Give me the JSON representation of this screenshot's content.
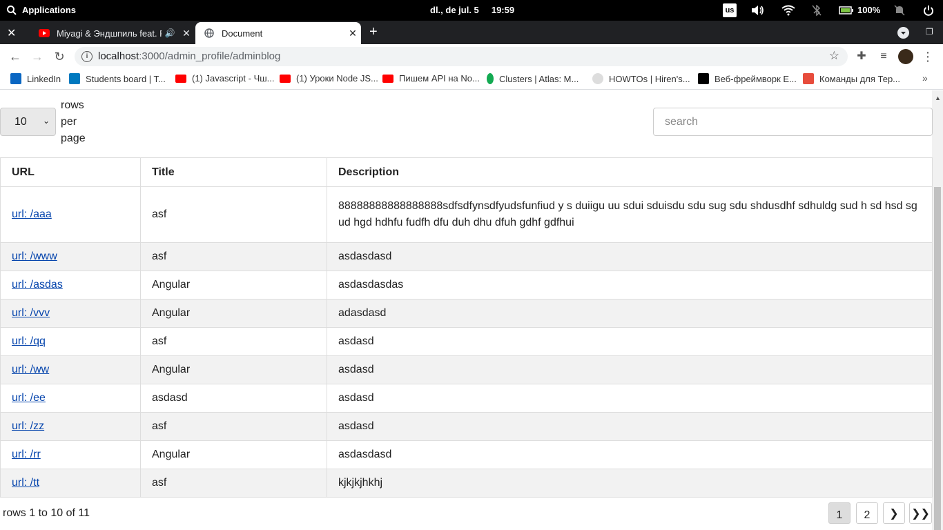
{
  "os": {
    "applications": "Applications",
    "clock": "dl., de jul. 5     19:59",
    "keyboard": "us",
    "battery": "100%"
  },
  "browser": {
    "tabs": [
      {
        "title": "Miyagi & Эндшпиль feat. F",
        "active": false
      },
      {
        "title": "Document",
        "active": true
      }
    ],
    "url_host": "localhost",
    "url_path": ":3000/admin_profile/adminblog",
    "bookmarks": [
      {
        "label": "LinkedIn",
        "color": "#0a66c2"
      },
      {
        "label": "Students board | T...",
        "color": "#0079bf"
      },
      {
        "label": "(1) Javascript - Чш...",
        "color": "#ff0000"
      },
      {
        "label": "(1) Уроки Node JS...",
        "color": "#ff0000"
      },
      {
        "label": "Пишем API на No...",
        "color": "#ff0000"
      },
      {
        "label": "Clusters | Atlas: M...",
        "color": "#13aa52"
      },
      {
        "label": "HOWTOs | Hiren's...",
        "color": "#999999"
      },
      {
        "label": "Веб-фреймворк Е...",
        "color": "#000000"
      },
      {
        "label": "Команды для Тер...",
        "color": "#e74c3c"
      }
    ]
  },
  "controls": {
    "rows_per_page_value": "10",
    "rows_per_page_label": "rows per page",
    "search_placeholder": "search"
  },
  "table": {
    "headers": [
      "URL",
      "Title",
      "Description"
    ],
    "rows": [
      {
        "url": "url: /aaa",
        "title": "asf",
        "description": "88888888888888888sdfsdfynsdfyudsfunfiud y  s duiigu  uu sdui  sduisdu sdu sug sdu shdusdhf sdhuldg sud h  sd hsd sg ud hgd hdhfu  fudfh dfu duh dhu dfuh gdhf gdfhui"
      },
      {
        "url": "url: /www",
        "title": "asf",
        "description": "asdasdasd"
      },
      {
        "url": "url: /asdas",
        "title": "Angular",
        "description": "asdasdasdas"
      },
      {
        "url": "url: /vvv",
        "title": "Angular",
        "description": "adasdasd"
      },
      {
        "url": "url: /qq",
        "title": "asf",
        "description": "asdasd"
      },
      {
        "url": "url: /ww",
        "title": "Angular",
        "description": "asdasd"
      },
      {
        "url": "url: /ee",
        "title": "asdasd",
        "description": "asdasd"
      },
      {
        "url": "url: /zz",
        "title": "asf",
        "description": "asdasd"
      },
      {
        "url": "url: /rr",
        "title": "Angular",
        "description": "asdasdasd"
      },
      {
        "url": "url: /tt",
        "title": "asf",
        "description": "kjkjkjhkhj"
      }
    ]
  },
  "footer": {
    "rows_info": "rows 1 to 10 of 11",
    "pages": [
      "1",
      "2"
    ],
    "next": "❯",
    "last": "❯❯",
    "current_page": "1"
  }
}
